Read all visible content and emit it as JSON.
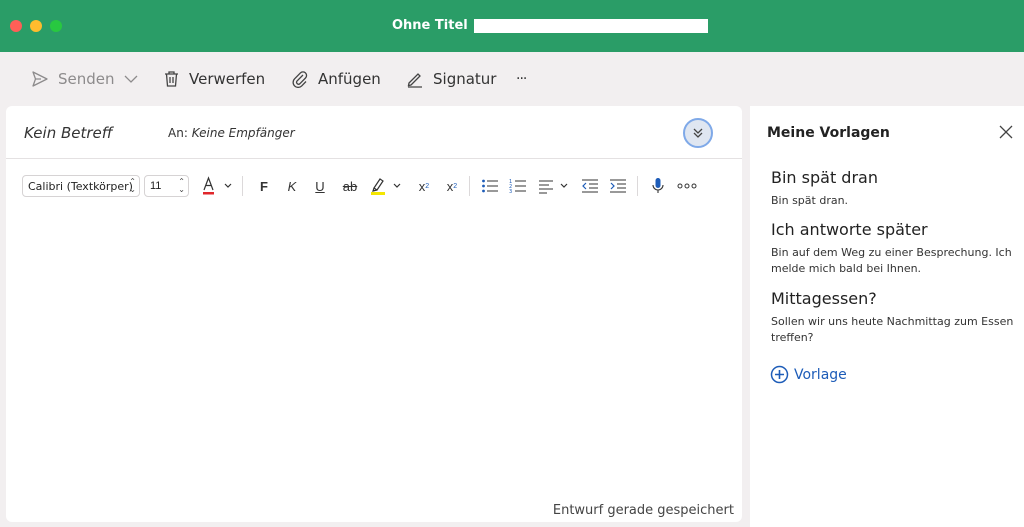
{
  "window": {
    "title": "Ohne Titel •"
  },
  "toolbar": {
    "send_label": "Senden",
    "discard_label": "Verwerfen",
    "attach_label": "Anfügen",
    "signature_label": "Signatur",
    "more_label": "···"
  },
  "compose": {
    "subject_placeholder": "Kein Betreff",
    "to_label": "An:",
    "to_placeholder": "Keine Empfänger",
    "font_name": "Calibri (Textkörper)",
    "font_size": "11",
    "bold_label": "F",
    "italic_label": "K",
    "underline_label": "U",
    "strikethrough_label": "ab",
    "superscript_label": "x",
    "subscript_label": "x",
    "font_color": "#e0262b",
    "highlight_color": "#f4e600",
    "status": "Entwurf gerade gespeichert"
  },
  "templates_panel": {
    "title": "Meine Vorlagen",
    "items": [
      {
        "title": "Bin spät dran",
        "body": "Bin spät dran."
      },
      {
        "title": "Ich antworte später",
        "body": "Bin auf dem Weg zu einer Besprechung. Ich melde mich bald bei Ihnen."
      },
      {
        "title": "Mittagessen?",
        "body": "Sollen wir uns heute Nachmittag zum Essen treffen?"
      }
    ],
    "add_label": "Vorlage"
  },
  "colors": {
    "titlebar": "#2a9d67",
    "accent": "#1d5cb8"
  }
}
